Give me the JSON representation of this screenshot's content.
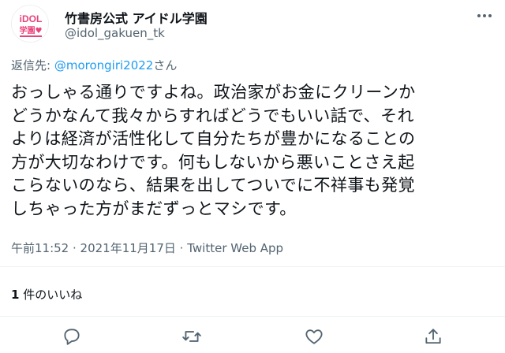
{
  "user": {
    "display_name": "竹書房公式 アイドル学園",
    "handle": "@idol_gakuen_tk",
    "avatar_text_top": "iDOL",
    "avatar_text_bottom": "学園♥"
  },
  "reply": {
    "prefix": "返信先:",
    "mention": "@morongiri2022",
    "suffix": "さん"
  },
  "tweet_lines": [
    "おっしゃる通りですよね。政治家がお金にクリーンか",
    "どうかなんて我々からすればどうでもいい話で、それ",
    "よりは経済が活性化して自分たちが豊かになることの",
    "方が大切なわけです。何もしないから悪いことさえ起",
    "こらないのなら、結果を出してついでに不祥事も発覚",
    "しちゃった方がまだずっとマシです。"
  ],
  "meta": {
    "time": "午前11:52",
    "sep1": " · ",
    "date": "2021年11月17日",
    "sep2": " · ",
    "app": "Twitter Web App"
  },
  "likes": {
    "count": "1",
    "label": " 件のいいね"
  },
  "actions": [
    "reply-icon",
    "retweet-icon",
    "like-icon",
    "share-icon"
  ],
  "colors": {
    "link": "#1d9bf0",
    "secondary": "#536471",
    "avatar_pink": "#e8437a"
  }
}
